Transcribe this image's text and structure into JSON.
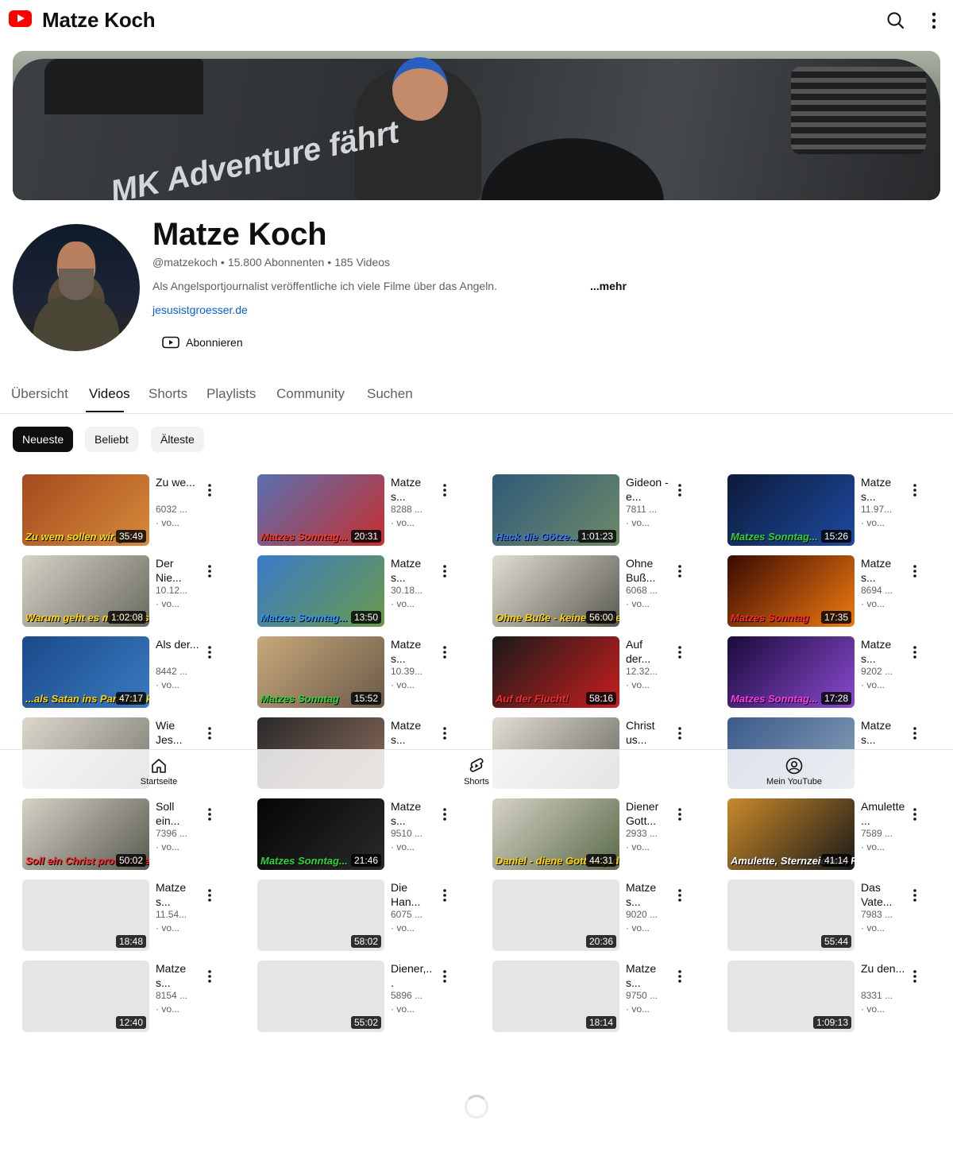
{
  "topbar": {
    "title": "Matze Koch",
    "logo_icon": "youtube-logo-icon",
    "search_icon": "search-icon",
    "more_icon": "more-vertical-icon"
  },
  "banner": {
    "text": "MK Adventure fährt"
  },
  "channel": {
    "name": "Matze Koch",
    "handle": "@matzekoch",
    "subscribers": "15.800 Abonnenten",
    "video_count": "185 Videos",
    "separator": "•",
    "description": "Als Angelsportjournalist veröffentliche ich viele Filme über das Angeln.",
    "more_label": "...mehr",
    "link": "jesusistgroesser.de",
    "subscribe_label": "Abonnieren"
  },
  "tabs": [
    "Übersicht",
    "Videos",
    "Shorts",
    "Playlists",
    "Community",
    "Suchen"
  ],
  "active_tab": "Videos",
  "chips": [
    "Neueste",
    "Beliebt",
    "Älteste"
  ],
  "active_chip": "Neueste",
  "videos": [
    {
      "title": "Zu we...",
      "views": "6032 ...",
      "age": "· vo...",
      "duration": "35:49",
      "overlay": "Zu wem sollen wir g...",
      "colors": [
        "#a24a1e",
        "#d88a3a"
      ],
      "overlay_color": "#f5e10a"
    },
    {
      "title": "Matze s...",
      "views": "8288 ...",
      "age": "· vo...",
      "duration": "20:31",
      "overlay": "Matzes Sonntag...",
      "colors": [
        "#5a6fb0",
        "#c63030"
      ],
      "overlay_color": "#ff3a2a"
    },
    {
      "title": "Gideon - e...",
      "views": "7811 ...",
      "age": "· vo...",
      "duration": "1:01:23",
      "overlay": "Hack die Götze...",
      "colors": [
        "#2f5a78",
        "#6e8a6a"
      ],
      "overlay_color": "#3a7cff"
    },
    {
      "title": "Matze s...",
      "views": "11.97...",
      "age": "· vo...",
      "duration": "15:26",
      "overlay": "Matzes Sonntag...",
      "colors": [
        "#0d1a3a",
        "#1e4aa0"
      ],
      "overlay_color": "#2fd43a"
    },
    {
      "title": "Der Nie...",
      "views": "10.12...",
      "age": "· vo...",
      "duration": "1:02:08",
      "overlay": "Warum geht es mit Deutschl...",
      "colors": [
        "#d6d2c6",
        "#6a6a60"
      ],
      "overlay_color": "#ffd400"
    },
    {
      "title": "Matze s...",
      "views": "30.18...",
      "age": "· vo...",
      "duration": "13:50",
      "overlay": "Matzes Sonntag...",
      "colors": [
        "#3a7ac8",
        "#6a9a4a"
      ],
      "overlay_color": "#2a9aff"
    },
    {
      "title": "Ohne Buß...",
      "views": "6068 ...",
      "age": "· vo...",
      "duration": "56:00",
      "overlay": "Ohne Buße - keine Gnade",
      "colors": [
        "#e2ddd2",
        "#5a5a52"
      ],
      "overlay_color": "#ffd400"
    },
    {
      "title": "Matze s...",
      "views": "8694 ...",
      "age": "· vo...",
      "duration": "17:35",
      "overlay": "Matzes Sonntag",
      "colors": [
        "#3a0a02",
        "#f07a10"
      ],
      "overlay_color": "#ff2a2a"
    },
    {
      "title": "Als der...",
      "views": "8442 ...",
      "age": "· vo...",
      "duration": "47:17",
      "overlay": "...als Satan ins Paradies kam",
      "colors": [
        "#1a4a8a",
        "#3a7ac0"
      ],
      "overlay_color": "#ffd400"
    },
    {
      "title": "Matze s...",
      "views": "10.39...",
      "age": "· vo...",
      "duration": "15:52",
      "overlay": "Matzes Sonntag",
      "colors": [
        "#c8a87a",
        "#6a5a4a"
      ],
      "overlay_color": "#2fd43a"
    },
    {
      "title": "Auf der...",
      "views": "12.32...",
      "age": "· vo...",
      "duration": "58:16",
      "overlay": "Auf der Flucht!",
      "colors": [
        "#1a1a1a",
        "#c81e1e"
      ],
      "overlay_color": "#ff2a2a"
    },
    {
      "title": "Matze s...",
      "views": "9202 ...",
      "age": "· vo...",
      "duration": "17:28",
      "overlay": "Matzes Sonntag...",
      "colors": [
        "#1a0a3a",
        "#8a4ad0"
      ],
      "overlay_color": "#ff3af0"
    },
    {
      "title": "Wie Jes...",
      "views": "",
      "age": "",
      "duration": "",
      "overlay": "",
      "colors": [
        "#ddd8cc",
        "#7a7a70"
      ],
      "overlay_color": "#ffd400"
    },
    {
      "title": "Matze s...",
      "views": "",
      "age": "",
      "duration": "",
      "overlay": "",
      "colors": [
        "#2a2a2a",
        "#8a6a5a"
      ],
      "overlay_color": "#ffd400"
    },
    {
      "title": "Christ us...",
      "views": "",
      "age": "",
      "duration": "",
      "overlay": "",
      "colors": [
        "#e2ddd2",
        "#6a6a62"
      ],
      "overlay_color": "#ffd400"
    },
    {
      "title": "Matze s...",
      "views": "",
      "age": "",
      "duration": "",
      "overlay": "",
      "colors": [
        "#3a5a8a",
        "#8aa0b8"
      ],
      "overlay_color": "#ffd400"
    },
    {
      "title": "Soll ein...",
      "views": "7396 ...",
      "age": "· vo...",
      "duration": "50:02",
      "overlay": "Soll ein Christ provozieren?",
      "colors": [
        "#d6d2c6",
        "#5a5a50"
      ],
      "overlay_color": "#ff2a2a"
    },
    {
      "title": "Matze s...",
      "views": "9510 ...",
      "age": "· vo...",
      "duration": "21:46",
      "overlay": "Matzes Sonntag...",
      "colors": [
        "#050505",
        "#2a2a2a"
      ],
      "overlay_color": "#2fd43a"
    },
    {
      "title": "Diener Gott...",
      "views": "2933 ...",
      "age": "· vo...",
      "duration": "44:31",
      "overlay": "Daniel - diene Gott zu jeder Zeit",
      "colors": [
        "#d6d2c6",
        "#5a6a4a"
      ],
      "overlay_color": "#ffd400"
    },
    {
      "title": "Amulette...",
      "views": "7589 ...",
      "age": "· vo...",
      "duration": "41:14",
      "overlay": "Amulette, Sternzeichen, Reliquien",
      "colors": [
        "#c88a2a",
        "#1a1a1a"
      ],
      "overlay_color": "#ffffff"
    },
    {
      "title": "Matze s...",
      "views": "11.54...",
      "age": "· vo...",
      "duration": "18:48",
      "overlay": "",
      "colors": [
        "#e5e5e5",
        "#e5e5e5"
      ],
      "overlay_color": "#ffd400"
    },
    {
      "title": "Die Han...",
      "views": "6075 ...",
      "age": "· vo...",
      "duration": "58:02",
      "overlay": "",
      "colors": [
        "#e5e5e5",
        "#e5e5e5"
      ],
      "overlay_color": "#ffd400"
    },
    {
      "title": "Matze s...",
      "views": "9020 ...",
      "age": "· vo...",
      "duration": "20:36",
      "overlay": "",
      "colors": [
        "#e5e5e5",
        "#e5e5e5"
      ],
      "overlay_color": "#ffd400"
    },
    {
      "title": "Das Vate...",
      "views": "7983 ...",
      "age": "· vo...",
      "duration": "55:44",
      "overlay": "",
      "colors": [
        "#e5e5e5",
        "#e5e5e5"
      ],
      "overlay_color": "#ffd400"
    },
    {
      "title": "Matze s...",
      "views": "8154 ...",
      "age": "· vo...",
      "duration": "12:40",
      "overlay": "",
      "colors": [
        "#e5e5e5",
        "#e5e5e5"
      ],
      "overlay_color": "#ffd400"
    },
    {
      "title": "Diener,...",
      "views": "5896 ...",
      "age": "· vo...",
      "duration": "55:02",
      "overlay": "",
      "colors": [
        "#e5e5e5",
        "#e5e5e5"
      ],
      "overlay_color": "#ffd400"
    },
    {
      "title": "Matze s...",
      "views": "9750 ...",
      "age": "· vo...",
      "duration": "18:14",
      "overlay": "",
      "colors": [
        "#e5e5e5",
        "#e5e5e5"
      ],
      "overlay_color": "#ffd400"
    },
    {
      "title": "Zu den...",
      "views": "8331 ...",
      "age": "· vo...",
      "duration": "1:09:13",
      "overlay": "",
      "colors": [
        "#e5e5e5",
        "#e5e5e5"
      ],
      "overlay_color": "#ffd400"
    }
  ],
  "bottom_nav": [
    {
      "label": "Startseite",
      "icon": "home-icon"
    },
    {
      "label": "Shorts",
      "icon": "shorts-icon"
    },
    {
      "label": "Mein YouTube",
      "icon": "account-icon"
    }
  ]
}
